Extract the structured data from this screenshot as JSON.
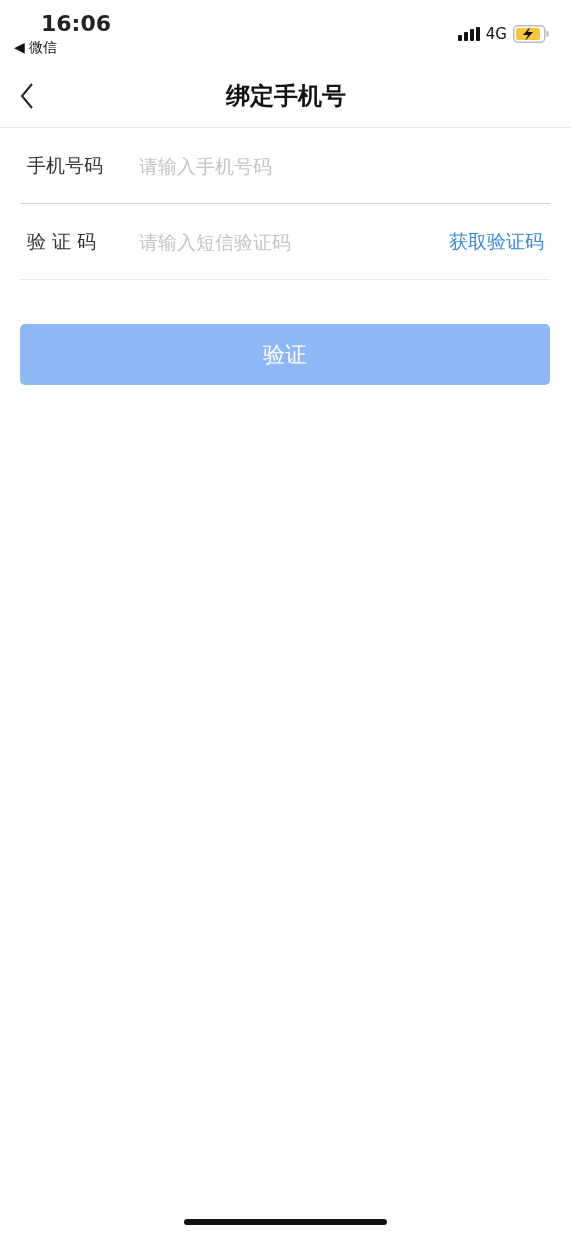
{
  "status_bar": {
    "time": "16:06",
    "back_app": "◀ 微信",
    "network": "4G",
    "charging": true
  },
  "nav_bar": {
    "title": "绑定手机号"
  },
  "form": {
    "fields": [
      {
        "label": "手机号码",
        "placeholder": "请输入手机号码"
      },
      {
        "label": "验 证 码",
        "placeholder": "请输入短信验证码",
        "action": "获取验证码"
      }
    ],
    "submit": {
      "label": "验证",
      "disabled": true
    }
  }
}
